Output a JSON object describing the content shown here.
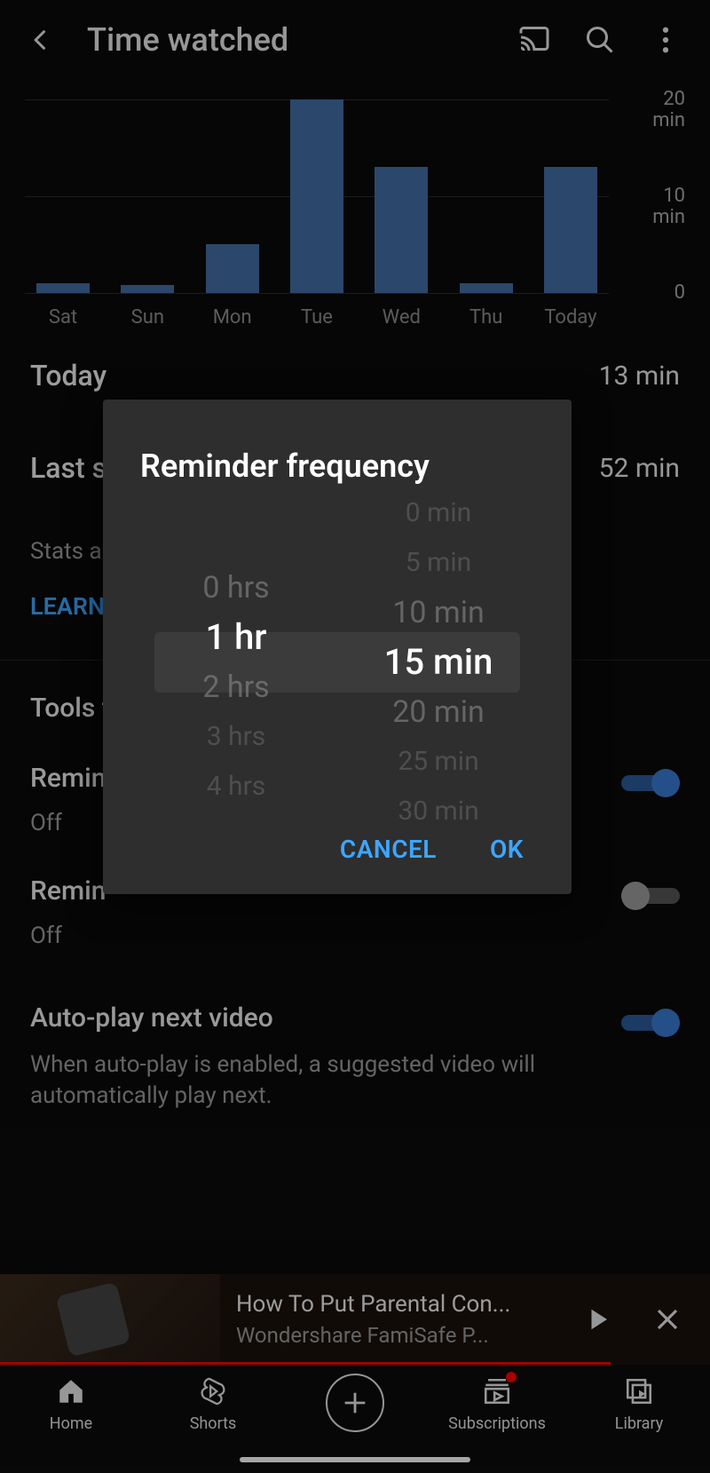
{
  "header": {
    "title": "Time watched"
  },
  "chart_data": {
    "type": "bar",
    "categories": [
      "Sat",
      "Sun",
      "Mon",
      "Tue",
      "Wed",
      "Thu",
      "Today"
    ],
    "values": [
      1,
      0.8,
      5,
      20,
      13,
      1,
      13
    ],
    "ylabel_lines": [
      {
        "v": 20,
        "text": "20\nmin"
      },
      {
        "v": 10,
        "text": "10\nmin"
      },
      {
        "v": 0,
        "text": "0"
      }
    ],
    "ylim": [
      0,
      22
    ],
    "title": "",
    "xlabel": "",
    "ylabel": ""
  },
  "stats": {
    "today_label": "Today",
    "today_value": "13 min",
    "last7_label_visible": "Last s",
    "last7_value": "52 min",
    "desc_visible": "Stats ar\nproduct",
    "learn_more": "LEARN"
  },
  "tools_section": {
    "title_visible": "Tools t",
    "rows": [
      {
        "title_visible": "Remin",
        "sub": "Off",
        "toggle": "on"
      },
      {
        "title_visible": "Remin",
        "sub": "Off",
        "toggle": "off"
      },
      {
        "title_full": "Auto-play next video",
        "desc": "When auto-play is enabled, a suggested video will automatically play next.",
        "toggle": "on"
      }
    ]
  },
  "miniplayer": {
    "title": "How To Put Parental Con...",
    "author": "Wondershare FamiSafe P..."
  },
  "nav": {
    "items": [
      "Home",
      "Shorts",
      "",
      "Subscriptions",
      "Library"
    ],
    "subs_badge": true
  },
  "dialog": {
    "title": "Reminder frequency",
    "hours": {
      "visible": [
        "",
        "0 hrs",
        "1 hr",
        "2 hrs",
        "3 hrs",
        "4 hrs"
      ],
      "selected_index": 2
    },
    "minutes": {
      "visible": [
        "0 min",
        "5 min",
        "10 min",
        "15 min",
        "20 min",
        "25 min",
        "30 min"
      ],
      "selected_index": 3
    },
    "cancel": "CANCEL",
    "ok": "OK"
  },
  "colors": {
    "accent": "#3ea6ff",
    "bar": "#426ea5"
  }
}
